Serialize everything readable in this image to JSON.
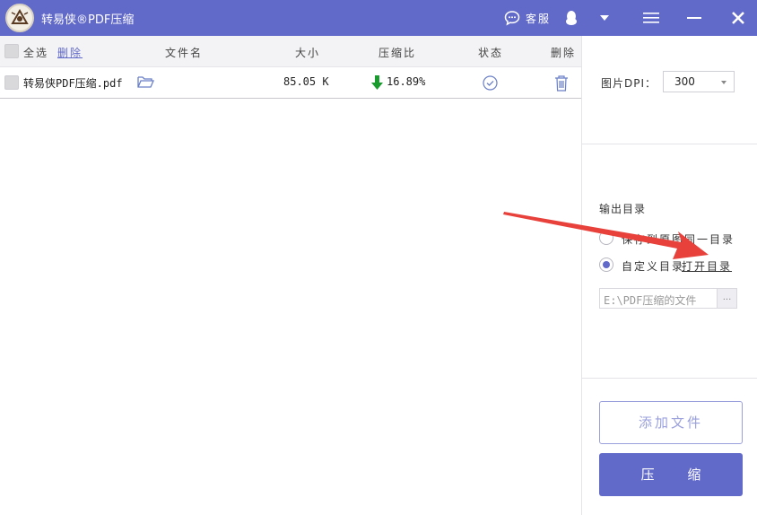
{
  "app": {
    "title": "转易侠®PDF压缩"
  },
  "titlebar": {
    "service_label": "客服"
  },
  "colors": {
    "accent": "#6169c9",
    "arrow": "#e8403a",
    "ratio_down": "#1a9b2e"
  },
  "list": {
    "header": {
      "select_all": "全选",
      "delete_link": "删除",
      "col_name": "文件名",
      "col_size": "大小",
      "col_ratio": "压缩比",
      "col_status": "状态",
      "col_delete": "删除"
    },
    "rows": [
      {
        "name": "转易侠PDF压缩.pdf",
        "size": "85.05 K",
        "ratio": "16.89%",
        "status_icon": "check-circle-icon",
        "delete_icon": "trash-icon"
      }
    ]
  },
  "panel": {
    "dpi_label": "图片DPI：",
    "dpi_value": "300",
    "output_label": "输出目录",
    "option_same": "保存到原图同一目录",
    "option_custom": "自定义目录",
    "open_dir_link": "打开目录",
    "path_value": "E:\\PDF压缩的文件",
    "browse_label": "...",
    "add_file_button": "添加文件",
    "compress_button": "压 缩"
  }
}
